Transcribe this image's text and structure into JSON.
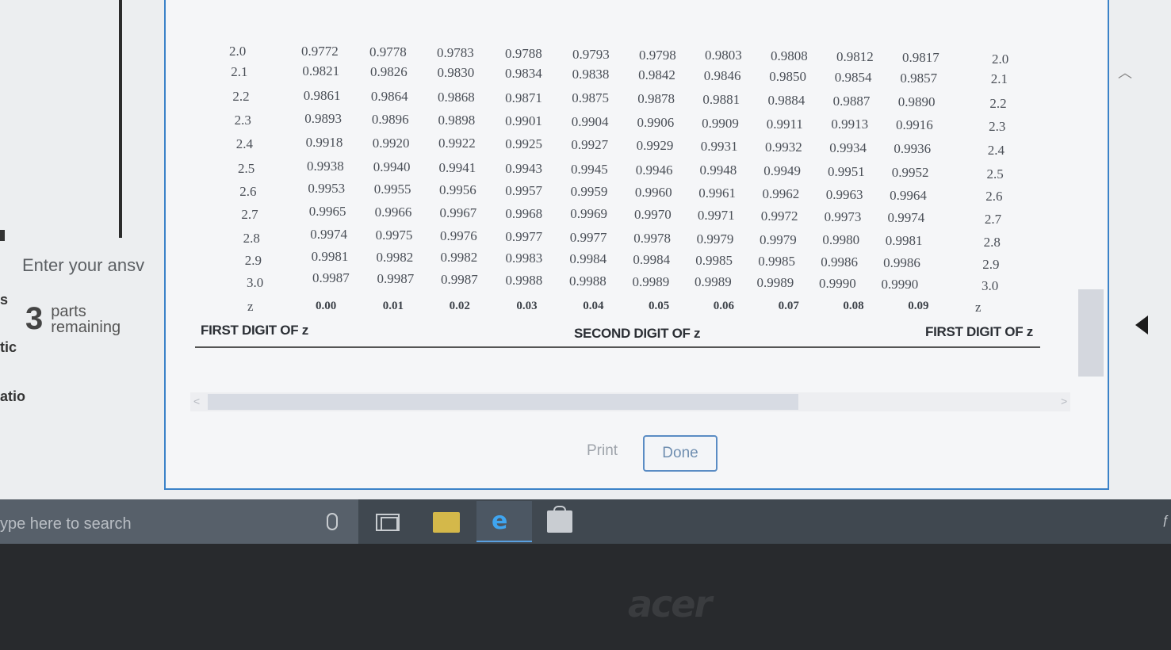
{
  "left_panel": {
    "answer_prompt": "Enter your ansv",
    "parts_count": "3",
    "parts_label_1": "parts",
    "parts_label_2": "remaining",
    "fragments": [
      "s",
      "tic",
      "atio"
    ]
  },
  "table": {
    "rows": [
      {
        "z": "2.0",
        "values": [
          "0.9772",
          "0.9778",
          "0.9783",
          "0.9788",
          "0.9793",
          "0.9798",
          "0.9803",
          "0.9808",
          "0.9812",
          "0.9817"
        ],
        "z_right": "2.0"
      },
      {
        "z": "2.1",
        "values": [
          "0.9821",
          "0.9826",
          "0.9830",
          "0.9834",
          "0.9838",
          "0.9842",
          "0.9846",
          "0.9850",
          "0.9854",
          "0.9857"
        ],
        "z_right": "2.1"
      },
      {
        "z": "2.2",
        "values": [
          "0.9861",
          "0.9864",
          "0.9868",
          "0.9871",
          "0.9875",
          "0.9878",
          "0.9881",
          "0.9884",
          "0.9887",
          "0.9890"
        ],
        "z_right": "2.2"
      },
      {
        "z": "2.3",
        "values": [
          "0.9893",
          "0.9896",
          "0.9898",
          "0.9901",
          "0.9904",
          "0.9906",
          "0.9909",
          "0.9911",
          "0.9913",
          "0.9916"
        ],
        "z_right": "2.3"
      },
      {
        "z": "2.4",
        "values": [
          "0.9918",
          "0.9920",
          "0.9922",
          "0.9925",
          "0.9927",
          "0.9929",
          "0.9931",
          "0.9932",
          "0.9934",
          "0.9936"
        ],
        "z_right": "2.4"
      },
      {
        "z": "2.5",
        "values": [
          "0.9938",
          "0.9940",
          "0.9941",
          "0.9943",
          "0.9945",
          "0.9946",
          "0.9948",
          "0.9949",
          "0.9951",
          "0.9952"
        ],
        "z_right": "2.5"
      },
      {
        "z": "2.6",
        "values": [
          "0.9953",
          "0.9955",
          "0.9956",
          "0.9957",
          "0.9959",
          "0.9960",
          "0.9961",
          "0.9962",
          "0.9963",
          "0.9964"
        ],
        "z_right": "2.6"
      },
      {
        "z": "2.7",
        "values": [
          "0.9965",
          "0.9966",
          "0.9967",
          "0.9968",
          "0.9969",
          "0.9970",
          "0.9971",
          "0.9972",
          "0.9973",
          "0.9974"
        ],
        "z_right": "2.7"
      },
      {
        "z": "2.8",
        "values": [
          "0.9974",
          "0.9975",
          "0.9976",
          "0.9977",
          "0.9977",
          "0.9978",
          "0.9979",
          "0.9979",
          "0.9980",
          "0.9981"
        ],
        "z_right": "2.8"
      },
      {
        "z": "2.9",
        "values": [
          "0.9981",
          "0.9982",
          "0.9982",
          "0.9983",
          "0.9984",
          "0.9984",
          "0.9985",
          "0.9985",
          "0.9986",
          "0.9986"
        ],
        "z_right": "2.9"
      },
      {
        "z": "3.0",
        "values": [
          "0.9987",
          "0.9987",
          "0.9987",
          "0.9988",
          "0.9988",
          "0.9989",
          "0.9989",
          "0.9989",
          "0.9990",
          "0.9990"
        ],
        "z_right": "3.0"
      }
    ],
    "z_symbol": "z",
    "column_headers": [
      "0.00",
      "0.01",
      "0.02",
      "0.03",
      "0.04",
      "0.05",
      "0.06",
      "0.07",
      "0.08",
      "0.09"
    ],
    "footer_left": "FIRST DIGIT OF z",
    "footer_center": "SECOND DIGIT OF z",
    "footer_right": "FIRST DIGIT OF z"
  },
  "buttons": {
    "print": "Print",
    "done": "Done"
  },
  "taskbar": {
    "search_placeholder": "ype here to search",
    "tray_glyph": "ƒ"
  },
  "bezel": {
    "brand": "acer"
  }
}
